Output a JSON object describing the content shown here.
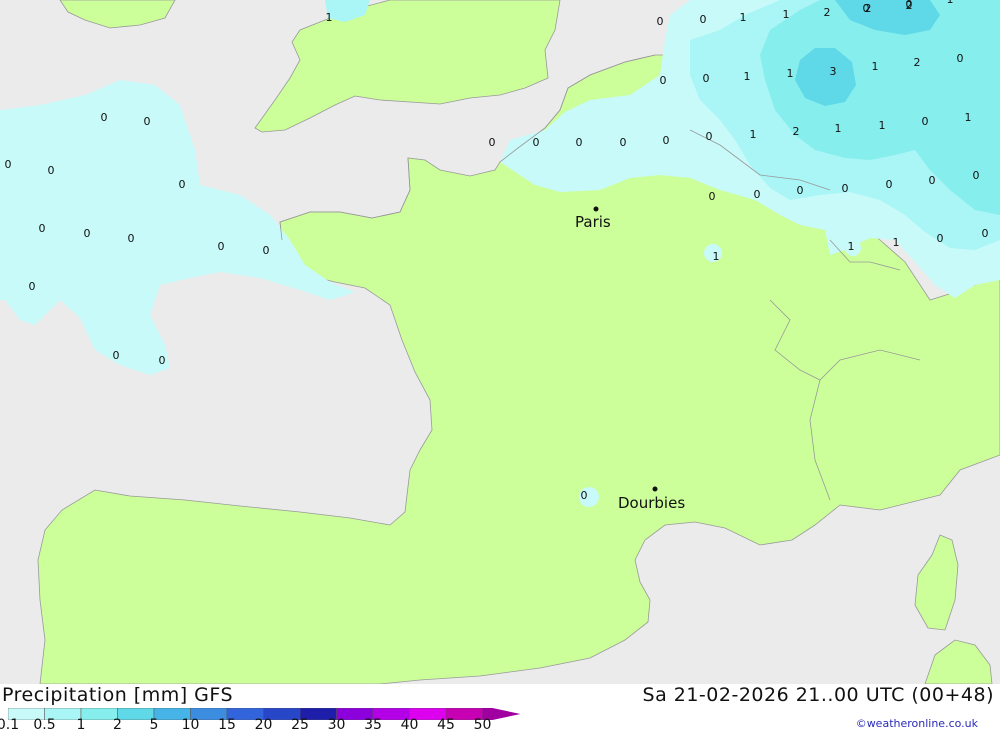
{
  "map": {
    "cities": [
      {
        "name": "Paris"
      },
      {
        "name": "Dourbies"
      }
    ],
    "values": [
      "0",
      "0",
      "1",
      "1",
      "2",
      "2",
      "2",
      "1",
      "0",
      "0",
      "1",
      "1",
      "3",
      "1",
      "2",
      "0",
      "0",
      "0",
      "0",
      "0",
      "0",
      "0",
      "1",
      "2",
      "1",
      "1",
      "0",
      "1",
      "0",
      "0",
      "0",
      "0",
      "0",
      "0",
      "0",
      "1",
      "1",
      "0",
      "0",
      "1",
      "1",
      "0",
      "0",
      "0",
      "0",
      "0",
      "0",
      "0",
      "0",
      "0",
      "0",
      "0",
      "0",
      "0",
      "0",
      "0",
      "0"
    ]
  },
  "footer": {
    "title": "Precipitation [mm] GFS",
    "valid": "Sa 21-02-2026 21..00 UTC (00+48)",
    "credit": "©weatheronline.co.uk"
  },
  "legend": {
    "labels": [
      "0.1",
      "0.5",
      "1",
      "2",
      "5",
      "10",
      "15",
      "20",
      "25",
      "30",
      "35",
      "40",
      "45",
      "50"
    ],
    "colors": [
      "#c8fafa",
      "#aaf5f5",
      "#87eeee",
      "#5fd8e8",
      "#46b4e6",
      "#3c8ce0",
      "#3264dc",
      "#2846c8",
      "#1e1eaa",
      "#8c00dc",
      "#b400e6",
      "#dc00ee",
      "#c800b4",
      "#a000a0"
    ]
  }
}
